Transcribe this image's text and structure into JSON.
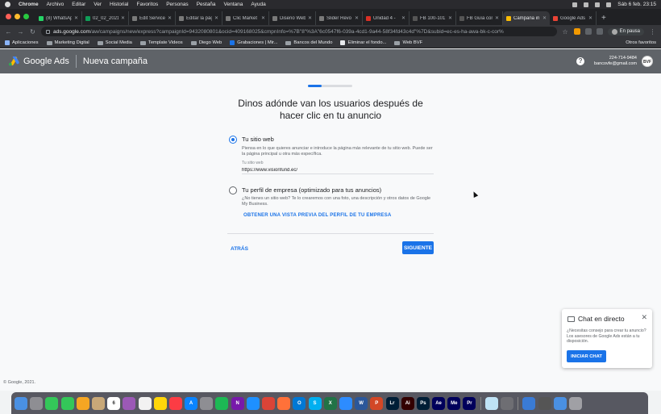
{
  "mac_menubar": {
    "app_name": "Chrome",
    "menus": [
      "Archivo",
      "Editar",
      "Ver",
      "Historial",
      "Favoritos",
      "Personas",
      "Pestaña",
      "Ventana",
      "Ayuda"
    ],
    "clock": "Sáb 6 feb.  23:15"
  },
  "browser": {
    "tabs": [
      {
        "title": "(8) WhatsApp",
        "color": "#25d366"
      },
      {
        "title": "02_02_2021",
        "color": "#0f9d58"
      },
      {
        "title": "Edit Service",
        "color": "#7a7a7a"
      },
      {
        "title": "Editar la pág",
        "color": "#7a7a7a"
      },
      {
        "title": "Clic Market",
        "color": "#7a7a7a"
      },
      {
        "title": "Diseño Web",
        "color": "#7a7a7a"
      },
      {
        "title": "Slider Revo",
        "color": "#7a7a7a"
      },
      {
        "title": "Unidad 4 - ",
        "color": "#d93025"
      },
      {
        "title": "FB 100-101: Ex",
        "color": "#555"
      },
      {
        "title": "FB Guía comp",
        "color": "#555"
      },
      {
        "title": "Campaña in",
        "color": "#fbbc04",
        "active": true
      },
      {
        "title": "Google Ads",
        "color": "#ea4335"
      }
    ],
    "url_host": "ads.google.com",
    "url_path": "/aw/campaigns/new/express?campaignId=9432080801&ocid=409168025&cmpnInfo=%7B\"8\"%3A\"6c0547f6-039a-4cd1-9a44-58f34fd43c4d\"%7D&subid=ec-es-ha-awa-bk-c-cor%",
    "profile_status": "En pausa",
    "bookmarks": [
      "Aplicaciones",
      "Marketing Digital",
      "Social Media",
      "Template Videos",
      "Diego Web",
      "Grabaciones | Mir...",
      "Bancos del Mundo",
      "Eliminar el fondo...",
      "Web BVF"
    ],
    "other_bookmarks": "Otros favoritos"
  },
  "header": {
    "brand": "Google Ads",
    "page_title": "Nueva campaña",
    "account_id": "224-714-9484",
    "account_email": "bancovfe@gmail.com",
    "avatar_text": "BVF"
  },
  "wizard": {
    "progress_fraction": 0.3,
    "question": "Dinos adónde van los usuarios después de hacer clic en tu anuncio",
    "option_website": {
      "label": "Tu sitio web",
      "description": "Piensa en lo que quieres anunciar e introduce la página más relevante de tu sitio web. Puede ser la página principal u otra más específica.",
      "field_label": "Tu sitio web",
      "field_value": "https://www.visionfund.ec/",
      "selected": true
    },
    "option_profile": {
      "label": "Tu perfil de empresa (optimizado para tus anuncios)",
      "description": "¿No tienes un sitio web? Te lo crearemos con una foto, una descripción y otros datos de Google My Business.",
      "preview_link": "OBTENER UNA VISTA PREVIA DEL PERFIL DE TU EMPRESA",
      "selected": false
    },
    "back_label": "ATRÁS",
    "next_label": "SIGUIENTE"
  },
  "chat": {
    "title": "Chat en directo",
    "description": "¿Necesitas consejo para crear tu anuncio? Los asesores de Google Ads están a tu disposición.",
    "button": "INICIAR CHAT"
  },
  "footer": {
    "copyright": "© Google, 2021."
  },
  "dock": [
    {
      "name": "finder-icon",
      "color": "#4a90e2",
      "text": ""
    },
    {
      "name": "launchpad-icon",
      "color": "#8e8e93",
      "text": ""
    },
    {
      "name": "facetime-icon",
      "color": "#34c759",
      "text": ""
    },
    {
      "name": "messages-icon",
      "color": "#34c759",
      "text": ""
    },
    {
      "name": "photos-icon",
      "color": "#f5a623",
      "text": ""
    },
    {
      "name": "contacts-icon",
      "color": "#c8a878",
      "text": ""
    },
    {
      "name": "calendar-icon",
      "color": "#ffffff",
      "text": "6"
    },
    {
      "name": "podcasts-icon",
      "color": "#9b59b6",
      "text": ""
    },
    {
      "name": "reminders-icon",
      "color": "#f2f2f2",
      "text": ""
    },
    {
      "name": "notes-icon",
      "color": "#ffd60a",
      "text": ""
    },
    {
      "name": "music-icon",
      "color": "#fc3c44",
      "text": ""
    },
    {
      "name": "appstore-icon",
      "color": "#0a84ff",
      "text": "A"
    },
    {
      "name": "settings-icon",
      "color": "#8e8e93",
      "text": ""
    },
    {
      "name": "spotify-icon",
      "color": "#1db954",
      "text": ""
    },
    {
      "name": "onenote-icon",
      "color": "#7719aa",
      "text": "N"
    },
    {
      "name": "safari-icon",
      "color": "#1e90ff",
      "text": ""
    },
    {
      "name": "chrome-icon",
      "color": "#db4437",
      "text": ""
    },
    {
      "name": "firefox-icon",
      "color": "#ff7139",
      "text": ""
    },
    {
      "name": "outlook-icon",
      "color": "#0078d4",
      "text": "O"
    },
    {
      "name": "skype-icon",
      "color": "#00aff0",
      "text": "S"
    },
    {
      "name": "excel-icon",
      "color": "#217346",
      "text": "X"
    },
    {
      "name": "zoom-icon",
      "color": "#2d8cff",
      "text": ""
    },
    {
      "name": "word-icon",
      "color": "#2b579a",
      "text": "W"
    },
    {
      "name": "powerpoint-icon",
      "color": "#d24726",
      "text": "P"
    },
    {
      "name": "lightroom-icon",
      "color": "#001e36",
      "text": "Lr"
    },
    {
      "name": "illustrator-icon",
      "color": "#330000",
      "text": "Ai"
    },
    {
      "name": "photoshop-icon",
      "color": "#001e36",
      "text": "Ps"
    },
    {
      "name": "aftereffects-icon",
      "color": "#00005b",
      "text": "Ae"
    },
    {
      "name": "mediaencoder-icon",
      "color": "#00005b",
      "text": "Me"
    },
    {
      "name": "premiere-icon",
      "color": "#00005b",
      "text": "Pr"
    },
    {
      "name": "snowflake-app-icon",
      "color": "#bfe3f5",
      "text": ""
    },
    {
      "name": "preview-icon",
      "color": "#6e6e73",
      "text": ""
    },
    {
      "name": "downloads-icon",
      "color": "#3a7bd5",
      "text": ""
    },
    {
      "name": "screenshot-icon",
      "color": "#555555",
      "text": ""
    },
    {
      "name": "folder-icon",
      "color": "#4a90e2",
      "text": ""
    },
    {
      "name": "trash-icon",
      "color": "#a0a0a5",
      "text": ""
    }
  ]
}
